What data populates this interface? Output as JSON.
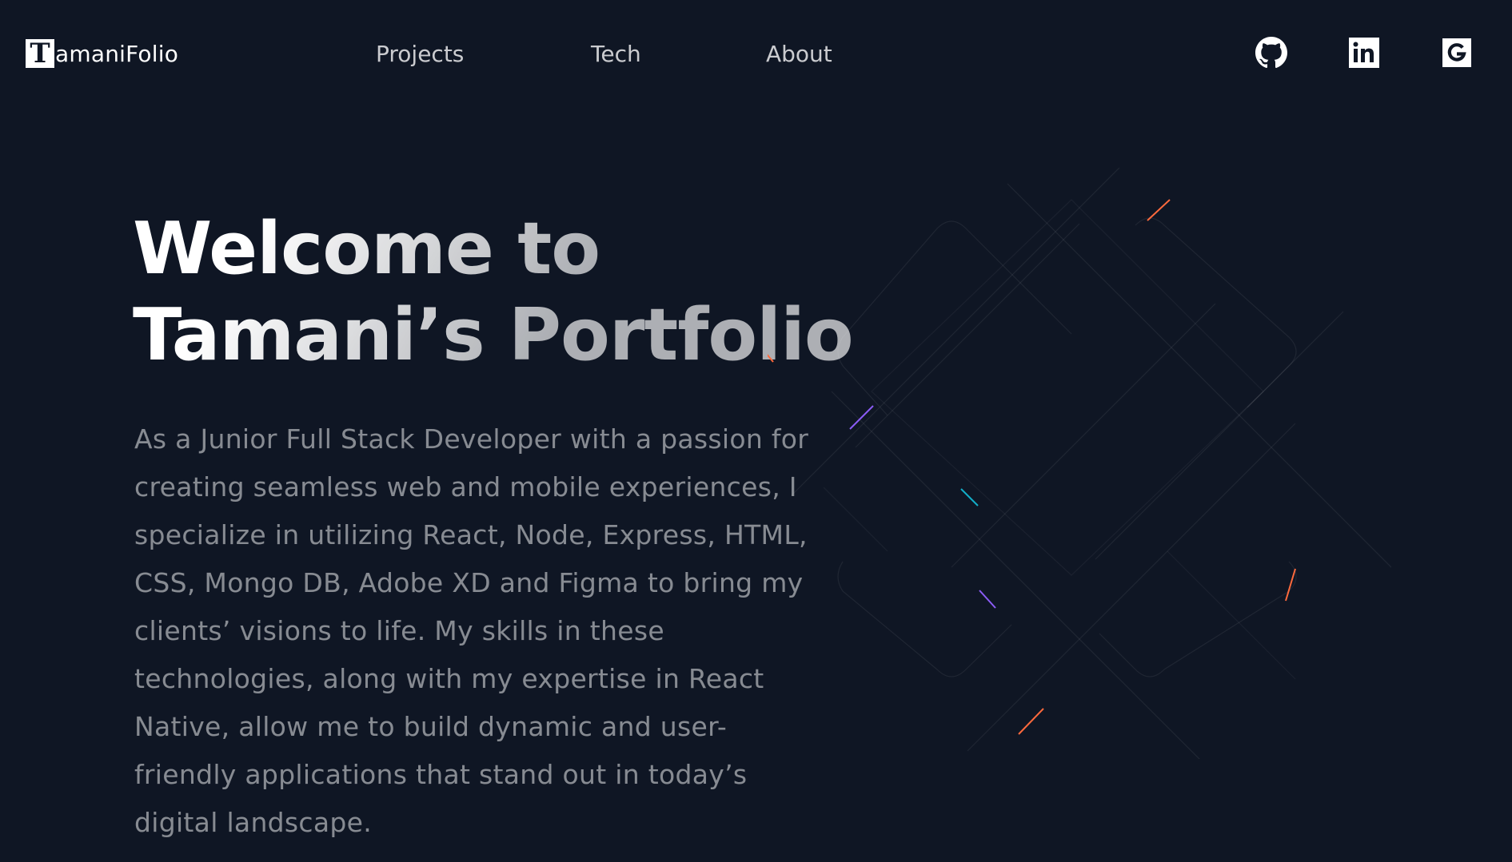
{
  "header": {
    "logo_mark": "T",
    "logo_text": "amaniFolio",
    "nav": [
      {
        "label": "Projects"
      },
      {
        "label": "Tech"
      },
      {
        "label": "About"
      }
    ],
    "social": [
      {
        "icon": "github-icon"
      },
      {
        "icon": "linkedin-icon"
      },
      {
        "icon": "google-icon"
      }
    ]
  },
  "hero": {
    "title_line1": "Welcome to",
    "title_line2": "Tamani’s Portfolio",
    "description": "As a Junior Full Stack Developer with a passion for creating seamless web and mobile experiences, I specialize in utilizing React, Node, Express, HTML, CSS, Mongo DB, Adobe XD and Figma to bring my clients’ visions to life. My skills in these technologies, along with my expertise in React Native, allow me to build dynamic and user-friendly applications that stand out in today’s digital landscape."
  },
  "colors": {
    "background": "#0f1624",
    "text": "#ffffff",
    "accent_orange": "#ff6a3d",
    "accent_purple": "#8b5cf6",
    "accent_cyan": "#13adc7"
  }
}
